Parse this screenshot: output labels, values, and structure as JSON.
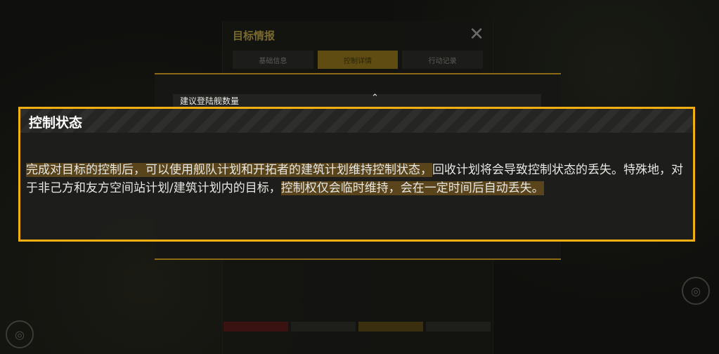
{
  "background_window": {
    "title": "目标情报",
    "close_icon": "close-icon",
    "tabs": [
      {
        "label": "基础信息",
        "active": false
      },
      {
        "label": "控制详情",
        "active": true
      },
      {
        "label": "行动记录",
        "active": false
      }
    ]
  },
  "panel": {
    "row_label": "建议登陆舰数量",
    "row_chevron": "⌃"
  },
  "tooltip": {
    "title": "控制状态",
    "segments": [
      {
        "text": "完成对目标的控制后，可以使用舰队计划和开拓者的建筑计划维持控制状态，",
        "highlight": true
      },
      {
        "text": "回收计划将会导致控制状态的丢失。特殊地，对于非己方和友方空间站计划/建筑计划内的目标，",
        "highlight": false
      },
      {
        "text": "控制权仅会临时维持，会在一定时间后自动丢失。",
        "highlight": true
      }
    ]
  },
  "colors": {
    "accent": "#f0b014",
    "highlight": "#6e521e"
  }
}
